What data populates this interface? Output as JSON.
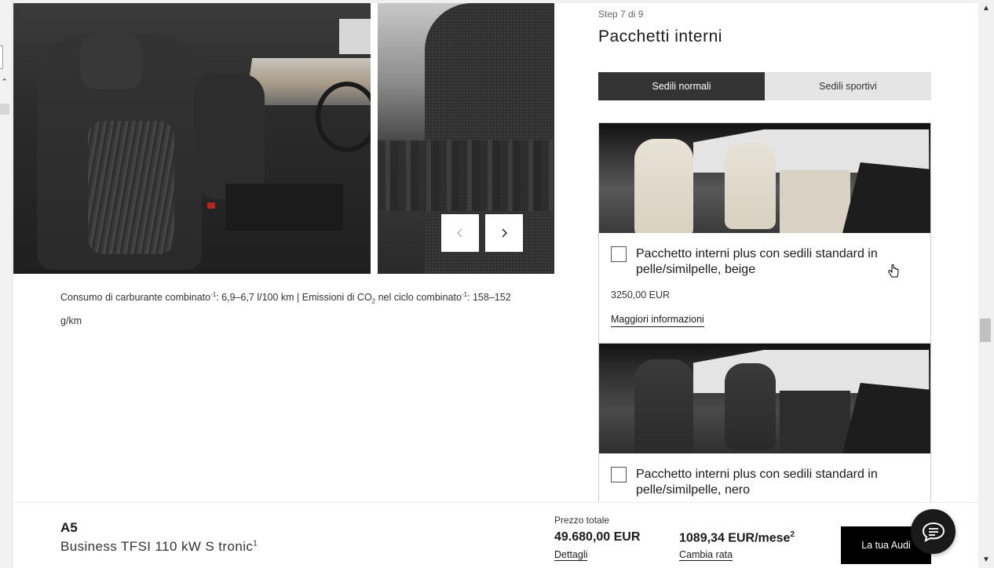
{
  "gallery": {
    "prev_icon": "chevron-left-icon",
    "next_icon": "chevron-right-icon"
  },
  "consumption": {
    "prefix": "Consumo di carburante combinato",
    "sup1": "-1",
    "fuel": ": 6,9–6,7 l/100 km | Emissioni di CO",
    "co2_sub": "2",
    "cycle": " nel ciclo combinato",
    "sup2": "-1",
    "emissions": ": 158–152 g/km"
  },
  "configurator": {
    "step": "Step 7 di 9",
    "title": "Pacchetti interni",
    "tabs": [
      {
        "label": "Sedili normali",
        "active": true
      },
      {
        "label": "Sedili sportivi",
        "active": false
      }
    ],
    "options": [
      {
        "label": "Pacchetto interni plus con sedili standard in pelle/similpelle, beige",
        "price": "3250,00 EUR",
        "more": "Maggiori informazioni",
        "checked": false
      },
      {
        "label": "Pacchetto interni plus con sedili standard in pelle/similpelle, nero",
        "checked": false
      }
    ]
  },
  "summary": {
    "model": "A5",
    "variant": "Business TFSI 110 kW S tronic",
    "variant_sup": "1",
    "price_label": "Prezzo totale",
    "total": "49.680,00 EUR",
    "details": "Dettagli",
    "monthly": "1089,34 EUR/mese",
    "monthly_sup": "2",
    "rate": "Cambia rata",
    "cta": "La tua Audi"
  },
  "chat": {
    "icon": "chat-bubble-icon"
  },
  "colors": {
    "accent": "#000000",
    "tab_active": "#333333",
    "tab_inactive": "#e5e5e5"
  }
}
